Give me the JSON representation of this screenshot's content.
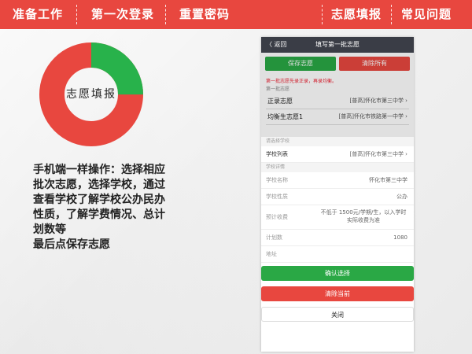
{
  "nav": {
    "items": [
      "准备工作",
      "第一次登录",
      "重置密码",
      "志愿填报",
      "常见问题"
    ]
  },
  "colors": {
    "red": "#e8473f",
    "green": "#28b24b"
  },
  "donut": {
    "label": "志愿填报",
    "green_fraction": 0.25
  },
  "description": {
    "lines": [
      "手机端一样操作：选择相应",
      "批次志愿，选择学校，通过",
      "查看学校了解学校公办民办",
      "性质，了解学费情况、总计",
      "划数等",
      "最后点保存志愿"
    ]
  },
  "phone": {
    "header": {
      "back": "〈 返回",
      "title": "填写第一批志愿"
    },
    "save_label": "保存志愿",
    "clear_all_label": "清除所有",
    "notice": "第一批志愿先录正录，再录均衡。",
    "section": "第一批志愿",
    "rows": [
      {
        "label": "正录志愿",
        "value": "[普高]怀化市第三中学 ›"
      },
      {
        "label": "均衡生志愿1",
        "value": "[普高]怀化市铁路第一中学 ›"
      }
    ],
    "sheet": {
      "cap1": "请选择学校",
      "school_list_label": "学校列表",
      "school_list_value": "[普高]怀化市第三中学 ›",
      "cap2": "学校详情",
      "details": [
        {
          "label": "学校名称",
          "value": "怀化市第三中学"
        },
        {
          "label": "学校性质",
          "value": "公办"
        },
        {
          "label": "预计收费",
          "value": "不低于 1500元/学期/生，以入学时实际收费为准"
        },
        {
          "label": "计划数",
          "value": "1080"
        },
        {
          "label": "地址",
          "value": ""
        }
      ],
      "confirm_label": "确认选择",
      "clear_current_label": "清除当前",
      "close_label": "关闭"
    }
  }
}
